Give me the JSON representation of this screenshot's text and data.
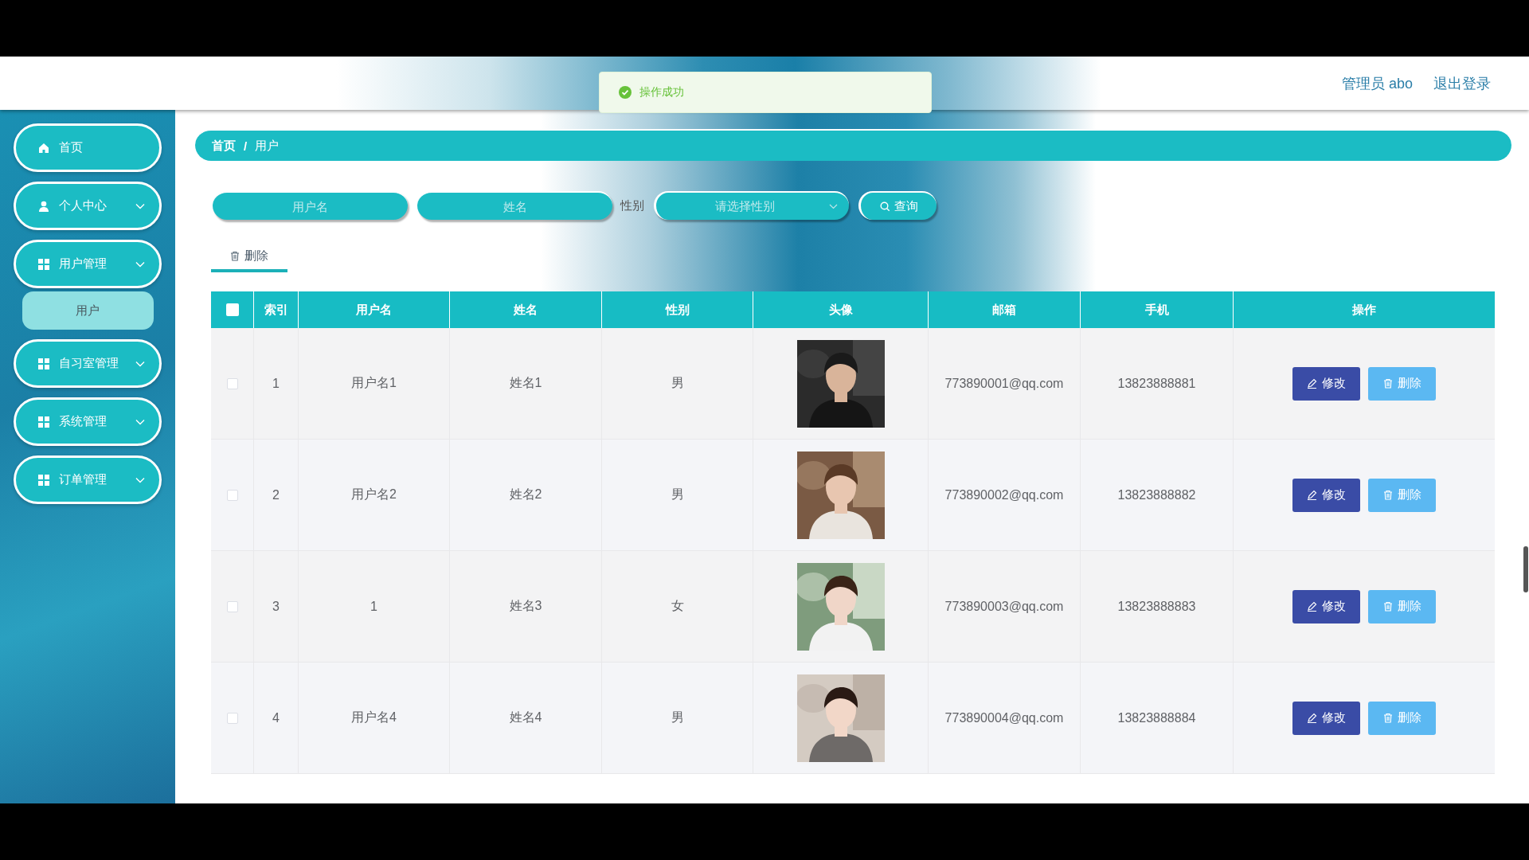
{
  "header": {
    "user": "管理员 abo",
    "logout": "退出登录"
  },
  "toast": {
    "kind": "success",
    "text": "操作成功"
  },
  "sidebar": {
    "items": [
      {
        "label": "首页",
        "has_submenu": false
      },
      {
        "label": "个人中心",
        "has_submenu": true
      },
      {
        "label": "用户管理",
        "has_submenu": true,
        "children": [
          {
            "label": "用户",
            "selected": true
          }
        ]
      },
      {
        "label": "自习室管理",
        "has_submenu": true
      },
      {
        "label": "系统管理",
        "has_submenu": true
      },
      {
        "label": "订单管理",
        "has_submenu": true
      }
    ]
  },
  "breadcrumb": {
    "items": [
      "首页",
      "用户"
    ],
    "separator": "/"
  },
  "filters": {
    "username": {
      "placeholder": "用户名"
    },
    "name": {
      "placeholder": "姓名"
    },
    "gender_label": "性别",
    "gender": {
      "placeholder": "请选择性别"
    },
    "search_button": "查询"
  },
  "delete_button": "删除",
  "table": {
    "select_all_checked": false,
    "columns": [
      "索引",
      "用户名",
      "姓名",
      "性别",
      "头像",
      "邮箱",
      "手机",
      "操作"
    ],
    "rows": [
      {
        "checked": false,
        "index": "1",
        "username": "用户名1",
        "name": "姓名1",
        "gender": "男",
        "email": "773890001@qq.com",
        "phone": "13823888881",
        "actions": [
          "修改",
          "删除"
        ]
      },
      {
        "checked": false,
        "index": "2",
        "username": "用户名2",
        "name": "姓名2",
        "gender": "男",
        "email": "773890002@qq.com",
        "phone": "13823888882",
        "actions": [
          "修改",
          "删除"
        ]
      },
      {
        "checked": false,
        "index": "3",
        "username": "1",
        "name": "姓名3",
        "gender": "女",
        "email": "773890003@qq.com",
        "phone": "13823888883",
        "actions": [
          "修改",
          "删除"
        ]
      },
      {
        "checked": false,
        "index": "4",
        "username": "用户名4",
        "name": "姓名4",
        "gender": "男",
        "email": "773890004@qq.com",
        "phone": "13823888884",
        "actions": [
          "修改",
          "删除"
        ]
      }
    ]
  }
}
